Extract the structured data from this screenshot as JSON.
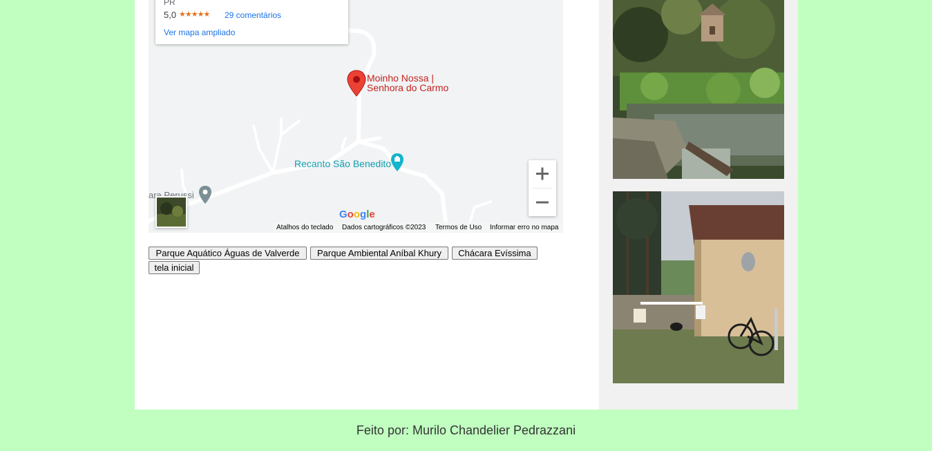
{
  "map": {
    "card": {
      "region": "PR",
      "rating": "5,0",
      "stars": "★★★★★",
      "reviews": "29 comentários",
      "larger_map": "Ver mapa ampliado"
    },
    "place_label_line1": "Moinho Nossa |",
    "place_label_line2": "Senhora do Carmo",
    "poi_label": "Recanto São Benedito",
    "west_label": "ara Perussi",
    "google": "Google",
    "attribution": {
      "shortcuts": "Atalhos do teclado",
      "data": "Dados cartográficos ©2023",
      "terms": "Termos de Uso",
      "report": "Informar erro no mapa"
    },
    "zoom_in": "+",
    "zoom_out": "−"
  },
  "buttons": [
    "Parque Aquático Águas de Valverde",
    "Parque Ambiental Aníbal Khury",
    "Chácara Evíssima",
    "tela inicial"
  ],
  "footer": "Feito por: Murilo Chandelier Pedrazzani",
  "colors": {
    "page_bg": "#c0ffc0",
    "content_bg": "#ffffff",
    "aside_bg": "#f1f1f1",
    "marker": "#ea4335",
    "link": "#1a73e8"
  }
}
